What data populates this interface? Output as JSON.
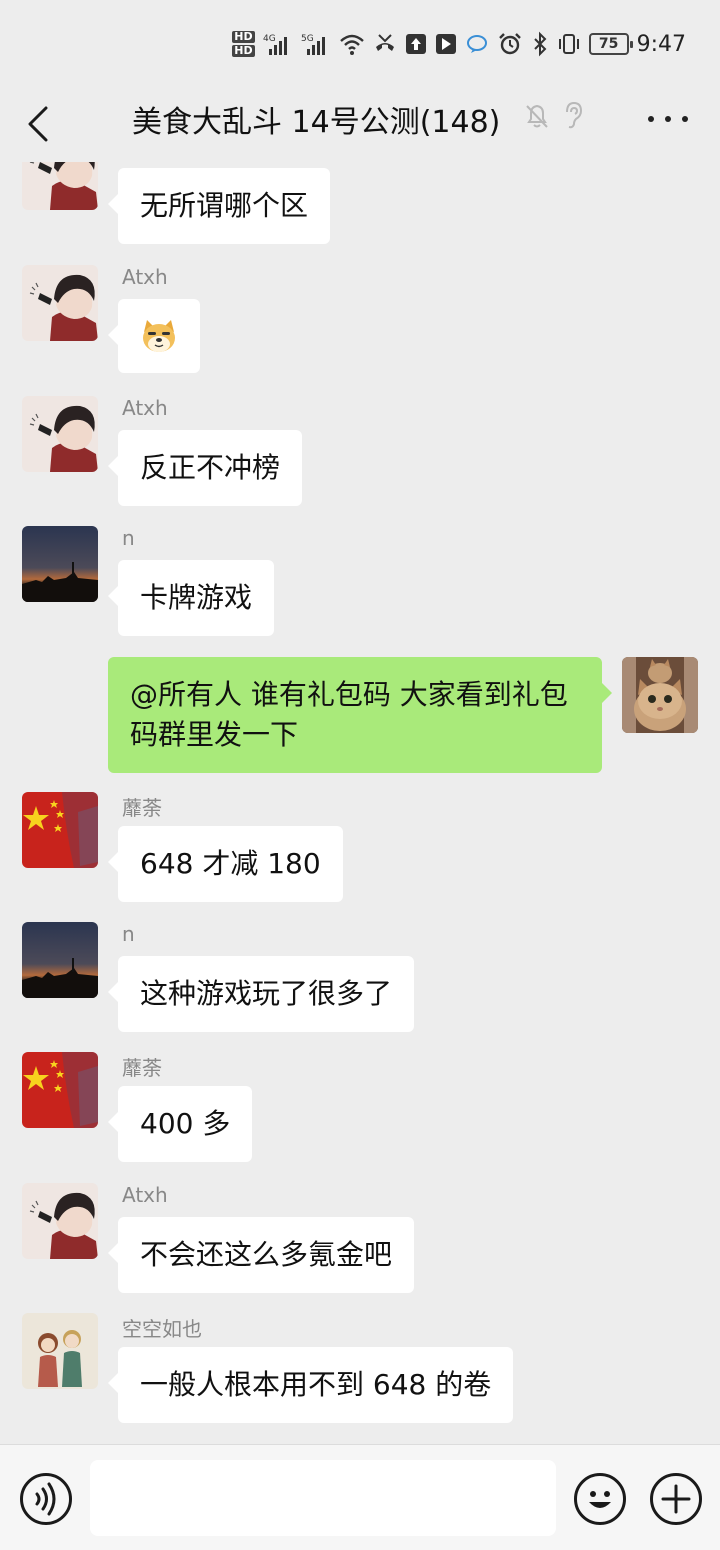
{
  "status_bar": {
    "hd1": "HD",
    "hd2": "HD",
    "net1": "4G",
    "net2": "5G",
    "battery": "75",
    "time": "9:47"
  },
  "header": {
    "title": "美食大乱斗 14号公测(148)",
    "icons": [
      "back-icon",
      "mute-icon",
      "ear-icon",
      "more-icon"
    ]
  },
  "messages": [
    {
      "sender": "",
      "text": "无所谓哪个区",
      "avatar": "boy-avatar"
    },
    {
      "sender": "Atxh",
      "text": "",
      "emoji": "doge-emoji",
      "avatar": "boy-avatar"
    },
    {
      "sender": "Atxh",
      "text": "反正不冲榜",
      "avatar": "boy-avatar"
    },
    {
      "sender": "n",
      "text": "卡牌游戏",
      "avatar": "sunset-avatar"
    },
    {
      "sender": "",
      "text": "@所有人  谁有礼包码 大家看到礼包码群里发一下",
      "avatar": "cat-avatar",
      "mine": true
    },
    {
      "sender": "蘼荼",
      "text": "648 才减 180",
      "avatar": "flag-avatar"
    },
    {
      "sender": "n",
      "text": "这种游戏玩了很多了",
      "avatar": "sunset-avatar"
    },
    {
      "sender": "蘼荼",
      "text": "400 多",
      "avatar": "flag-avatar"
    },
    {
      "sender": "Atxh",
      "text": "不会还这么多氪金吧",
      "avatar": "boy-avatar"
    },
    {
      "sender": "空空如也",
      "text": "一般人根本用不到 648 的卷",
      "avatar": "couple-avatar"
    }
  ],
  "input_bar": {
    "placeholder": "",
    "icons": [
      "voice-icon",
      "emoji-icon",
      "plus-icon"
    ]
  },
  "colors": {
    "background": "#ededed",
    "my_bubble": "#a9ea7a",
    "other_bubble": "#ffffff",
    "sender_name": "#888888"
  }
}
